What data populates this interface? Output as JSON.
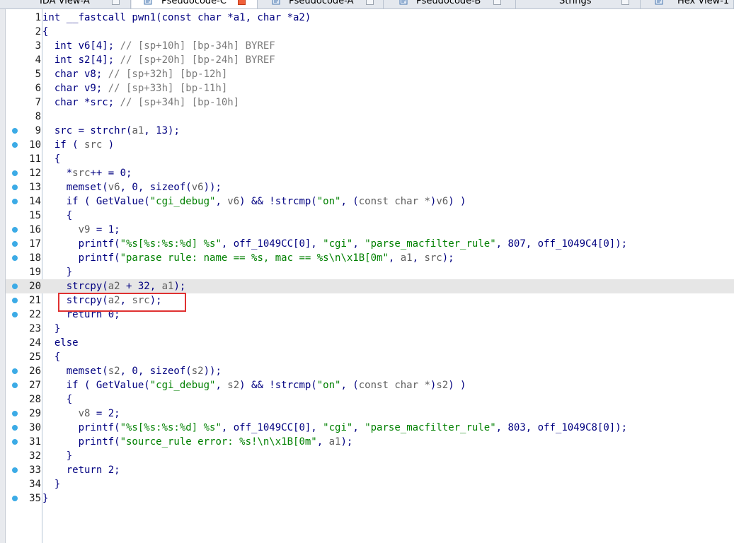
{
  "tabs": [
    {
      "label": "IDA View-A",
      "icon": "ida-view-icon",
      "active": false
    },
    {
      "label": "Pseudocode-C",
      "icon": "pseudocode-icon",
      "active": true
    },
    {
      "label": "Pseudocode-A",
      "icon": "pseudocode-icon",
      "active": false
    },
    {
      "label": "Pseudocode-B",
      "icon": "pseudocode-icon",
      "active": false
    },
    {
      "label": "Strings",
      "icon": "strings-icon",
      "active": false
    },
    {
      "label": "Hex View-1",
      "icon": "hex-view-icon",
      "active": false
    }
  ],
  "colors": {
    "breakpoint": "#3cabe6",
    "highlight_box": "#e03131",
    "current_line": "#e6e6e6"
  },
  "code": {
    "current_line": 20,
    "lines": [
      {
        "n": "1",
        "bp": false,
        "t": [
          [
            "k",
            "int __fastcall pwn1(const char *a1, char *a2)"
          ]
        ]
      },
      {
        "n": "2",
        "bp": false,
        "t": [
          [
            "k",
            "{"
          ]
        ]
      },
      {
        "n": "3",
        "bp": false,
        "t": [
          [
            "k",
            "  int v6[4]; "
          ],
          [
            "c",
            "// [sp+10h] [bp-34h] BYREF"
          ]
        ]
      },
      {
        "n": "4",
        "bp": false,
        "t": [
          [
            "k",
            "  int s2[4]; "
          ],
          [
            "c",
            "// [sp+20h] [bp-24h] BYREF"
          ]
        ]
      },
      {
        "n": "5",
        "bp": false,
        "t": [
          [
            "k",
            "  char v8; "
          ],
          [
            "c",
            "// [sp+32h] [bp-12h]"
          ]
        ]
      },
      {
        "n": "6",
        "bp": false,
        "t": [
          [
            "k",
            "  char v9; "
          ],
          [
            "c",
            "// [sp+33h] [bp-11h]"
          ]
        ]
      },
      {
        "n": "7",
        "bp": false,
        "t": [
          [
            "k",
            "  char *src; "
          ],
          [
            "c",
            "// [sp+34h] [bp-10h]"
          ]
        ]
      },
      {
        "n": "8",
        "bp": false,
        "t": [
          [
            "k",
            ""
          ]
        ]
      },
      {
        "n": "9",
        "bp": true,
        "t": [
          [
            "k",
            "  src = strchr("
          ],
          [
            "v",
            "a1"
          ],
          [
            "k",
            ", 13);"
          ]
        ]
      },
      {
        "n": "10",
        "bp": true,
        "t": [
          [
            "k",
            "  if ( "
          ],
          [
            "v",
            "src"
          ],
          [
            "k",
            " )"
          ]
        ]
      },
      {
        "n": "11",
        "bp": false,
        "t": [
          [
            "k",
            "  {"
          ]
        ]
      },
      {
        "n": "12",
        "bp": true,
        "t": [
          [
            "k",
            "    *"
          ],
          [
            "v",
            "src"
          ],
          [
            "k",
            "++ = 0;"
          ]
        ]
      },
      {
        "n": "13",
        "bp": true,
        "t": [
          [
            "k",
            "    memset("
          ],
          [
            "v",
            "v6"
          ],
          [
            "k",
            ", 0, sizeof("
          ],
          [
            "v",
            "v6"
          ],
          [
            "k",
            "));"
          ]
        ]
      },
      {
        "n": "14",
        "bp": true,
        "t": [
          [
            "k",
            "    if ( GetValue("
          ],
          [
            "s",
            "\"cgi_debug\""
          ],
          [
            "k",
            ", "
          ],
          [
            "v",
            "v6"
          ],
          [
            "k",
            ") && !strcmp("
          ],
          [
            "s",
            "\"on\""
          ],
          [
            "k",
            ", ("
          ],
          [
            "v",
            "const char *"
          ],
          [
            "k",
            ")"
          ],
          [
            "v",
            "v6"
          ],
          [
            "k",
            ") )"
          ]
        ]
      },
      {
        "n": "15",
        "bp": false,
        "t": [
          [
            "k",
            "    {"
          ]
        ]
      },
      {
        "n": "16",
        "bp": true,
        "t": [
          [
            "k",
            "      "
          ],
          [
            "v",
            "v9"
          ],
          [
            "k",
            " = 1;"
          ]
        ]
      },
      {
        "n": "17",
        "bp": true,
        "t": [
          [
            "k",
            "      printf("
          ],
          [
            "s",
            "\"%s[%s:%s:%d] %s\""
          ],
          [
            "k",
            ", off_1049CC[0], "
          ],
          [
            "s",
            "\"cgi\""
          ],
          [
            "k",
            ", "
          ],
          [
            "s",
            "\"parse_macfilter_rule\""
          ],
          [
            "k",
            ", 807, off_1049C4[0]);"
          ]
        ]
      },
      {
        "n": "18",
        "bp": true,
        "t": [
          [
            "k",
            "      printf("
          ],
          [
            "s",
            "\"parase rule: name == %s, mac == %s\\n\\x1B[0m\""
          ],
          [
            "k",
            ", "
          ],
          [
            "v",
            "a1"
          ],
          [
            "k",
            ", "
          ],
          [
            "v",
            "src"
          ],
          [
            "k",
            ");"
          ]
        ]
      },
      {
        "n": "19",
        "bp": false,
        "t": [
          [
            "k",
            "    }"
          ]
        ]
      },
      {
        "n": "20",
        "bp": true,
        "t": [
          [
            "k",
            "    strcpy("
          ],
          [
            "v",
            "a2"
          ],
          [
            "k",
            " + 32, "
          ],
          [
            "v",
            "a1"
          ],
          [
            "k",
            ");"
          ]
        ]
      },
      {
        "n": "21",
        "bp": true,
        "t": [
          [
            "k",
            "    strcpy("
          ],
          [
            "v",
            "a2"
          ],
          [
            "k",
            ", "
          ],
          [
            "v",
            "src"
          ],
          [
            "k",
            ");"
          ]
        ]
      },
      {
        "n": "22",
        "bp": true,
        "t": [
          [
            "k",
            "    return 0;"
          ]
        ]
      },
      {
        "n": "23",
        "bp": false,
        "t": [
          [
            "k",
            "  }"
          ]
        ]
      },
      {
        "n": "24",
        "bp": false,
        "t": [
          [
            "k",
            "  else"
          ]
        ]
      },
      {
        "n": "25",
        "bp": false,
        "t": [
          [
            "k",
            "  {"
          ]
        ]
      },
      {
        "n": "26",
        "bp": true,
        "t": [
          [
            "k",
            "    memset("
          ],
          [
            "v",
            "s2"
          ],
          [
            "k",
            ", 0, sizeof("
          ],
          [
            "v",
            "s2"
          ],
          [
            "k",
            "));"
          ]
        ]
      },
      {
        "n": "27",
        "bp": true,
        "t": [
          [
            "k",
            "    if ( GetValue("
          ],
          [
            "s",
            "\"cgi_debug\""
          ],
          [
            "k",
            ", "
          ],
          [
            "v",
            "s2"
          ],
          [
            "k",
            ") && !strcmp("
          ],
          [
            "s",
            "\"on\""
          ],
          [
            "k",
            ", ("
          ],
          [
            "v",
            "const char *"
          ],
          [
            "k",
            ")"
          ],
          [
            "v",
            "s2"
          ],
          [
            "k",
            ") )"
          ]
        ]
      },
      {
        "n": "28",
        "bp": false,
        "t": [
          [
            "k",
            "    {"
          ]
        ]
      },
      {
        "n": "29",
        "bp": true,
        "t": [
          [
            "k",
            "      "
          ],
          [
            "v",
            "v8"
          ],
          [
            "k",
            " = 2;"
          ]
        ]
      },
      {
        "n": "30",
        "bp": true,
        "t": [
          [
            "k",
            "      printf("
          ],
          [
            "s",
            "\"%s[%s:%s:%d] %s\""
          ],
          [
            "k",
            ", off_1049CC[0], "
          ],
          [
            "s",
            "\"cgi\""
          ],
          [
            "k",
            ", "
          ],
          [
            "s",
            "\"parse_macfilter_rule\""
          ],
          [
            "k",
            ", 803, off_1049C8[0]);"
          ]
        ]
      },
      {
        "n": "31",
        "bp": true,
        "t": [
          [
            "k",
            "      printf("
          ],
          [
            "s",
            "\"source_rule error: %s!\\n\\x1B[0m\""
          ],
          [
            "k",
            ", "
          ],
          [
            "v",
            "a1"
          ],
          [
            "k",
            ");"
          ]
        ]
      },
      {
        "n": "32",
        "bp": false,
        "t": [
          [
            "k",
            "    }"
          ]
        ]
      },
      {
        "n": "33",
        "bp": true,
        "t": [
          [
            "k",
            "    return 2;"
          ]
        ]
      },
      {
        "n": "34",
        "bp": false,
        "t": [
          [
            "k",
            "  }"
          ]
        ]
      },
      {
        "n": "35",
        "bp": true,
        "t": [
          [
            "k",
            "}"
          ]
        ]
      }
    ]
  }
}
